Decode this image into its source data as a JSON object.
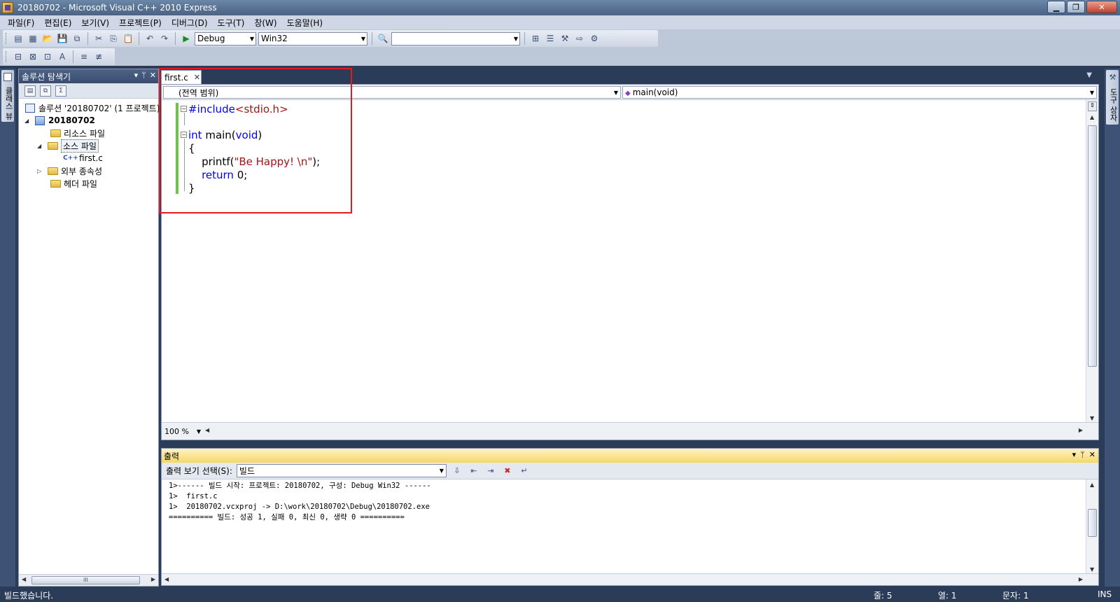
{
  "window": {
    "title": "20180702 - Microsoft Visual C++ 2010 Express",
    "minimize": "▁",
    "maximize": "❐",
    "close": "✕"
  },
  "menu": [
    "파일(F)",
    "편집(E)",
    "보기(V)",
    "프로젝트(P)",
    "디버그(D)",
    "도구(T)",
    "창(W)",
    "도움말(H)"
  ],
  "toolbar": {
    "config": "Debug",
    "platform": "Win32",
    "find_value": ""
  },
  "left_strip": {
    "tab_label": "클래스 뷰"
  },
  "right_strip": {
    "tab_label": "도구 상자"
  },
  "solution_explorer": {
    "title": "솔루션 탐색기",
    "pin": "ᛘ",
    "close": "✕",
    "dropdown": "▾",
    "tree": {
      "solution": "솔루션 '20180702' (1 프로젝트)",
      "project": "20180702",
      "resource_files": "리소스 파일",
      "source_files": "소스 파일",
      "first_c": "first.c",
      "external_deps": "외부 종속성",
      "header_files": "헤더 파일"
    },
    "hscroll_grip": "III"
  },
  "editor": {
    "tab_label": "first.c",
    "tab_close": "✕",
    "scope_combo": "(전역 범위)",
    "function_combo": "main(void)",
    "zoom": "100 %",
    "code": {
      "l1_kw": "#include",
      "l1_str": "<stdio.h>",
      "l3_kw1": "int",
      "l3_mid": " main(",
      "l3_kw2": "void",
      "l3_end": ")",
      "l4": "{",
      "l5_pre": "    printf(",
      "l5_str": "\"Be Happy! \\n\"",
      "l5_end": ");",
      "l6_kw": "    return",
      "l6_end": " 0;",
      "l7": "}"
    }
  },
  "output": {
    "title": "출력",
    "show_label": "출력 보기 선택(S):",
    "show_value": "빌드",
    "lines": [
      "1>------ 빌드 시작: 프로젝트: 20180702, 구성: Debug Win32 ------",
      "1>  first.c",
      "1>  20180702.vcxproj -> D:\\work\\20180702\\Debug\\20180702.exe",
      "========== 빌드: 성공 1, 실패 0, 최신 0, 생략 0 =========="
    ]
  },
  "status": {
    "message": "빌드했습니다.",
    "line": "줄: 5",
    "col": "열: 1",
    "ch": "문자: 1",
    "mode": "INS"
  }
}
